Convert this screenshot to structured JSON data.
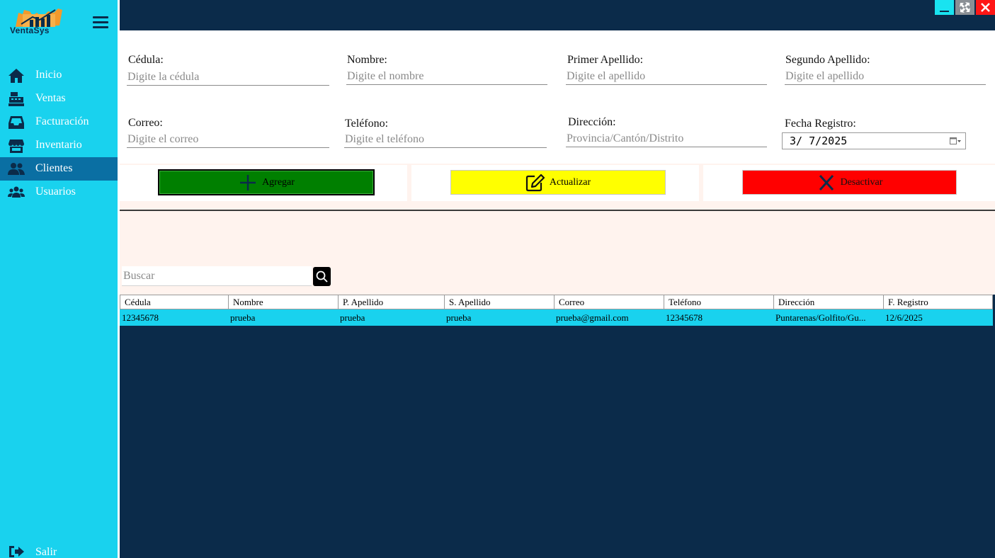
{
  "app": {
    "logo_text": "VentaSys"
  },
  "sidebar": {
    "items": [
      {
        "label": "Inicio",
        "icon": "home-icon"
      },
      {
        "label": "Ventas",
        "icon": "cash-register-icon"
      },
      {
        "label": "Facturación",
        "icon": "inbox-icon"
      },
      {
        "label": "Inventario",
        "icon": "store-icon"
      },
      {
        "label": "Clientes",
        "icon": "users-icon",
        "active": true
      },
      {
        "label": "Usuarios",
        "icon": "user-group-icon"
      }
    ],
    "logout_label": "Salir"
  },
  "form": {
    "cedula": {
      "label": "Cédula:",
      "placeholder": "Digite la cédula"
    },
    "nombre": {
      "label": "Nombre:",
      "placeholder": "Digite el nombre"
    },
    "primer_apellido": {
      "label": "Primer Apellido:",
      "placeholder": "Digite el apellido"
    },
    "segundo_apellido": {
      "label": "Segundo Apellido:",
      "placeholder": "Digite el apellido"
    },
    "correo": {
      "label": "Correo:",
      "placeholder": "Digite el correo"
    },
    "telefono": {
      "label": "Teléfono:",
      "placeholder": "Digite el teléfono"
    },
    "direccion": {
      "label": "Dirección:",
      "placeholder": "Provincia/Cantón/Distrito"
    },
    "fecha_registro": {
      "label": "Fecha Registro:",
      "value": "3/ 7/2025"
    }
  },
  "actions": {
    "add_label": "Agregar",
    "update_label": "Actualizar",
    "deactivate_label": "Desactivar"
  },
  "search": {
    "placeholder": "Buscar"
  },
  "table": {
    "columns": [
      "Cédula",
      "Nombre",
      "P. Apellido",
      "S. Apellido",
      "Correo",
      "Teléfono",
      "Dirección",
      "F. Registro"
    ],
    "rows": [
      [
        "12345678",
        "prueba",
        "prueba",
        "prueba",
        "prueba@gmail.com",
        "12345678",
        "Puntarenas/Golfito/Gu...",
        "12/6/2025"
      ]
    ]
  },
  "colors": {
    "sidebar": "#19d2ee",
    "active_nav": "#0a6fa3",
    "dark_bg": "#0b2b4a",
    "add_button": "#007f00",
    "update_button": "#ffff00",
    "deactivate_button": "#ff0000"
  }
}
